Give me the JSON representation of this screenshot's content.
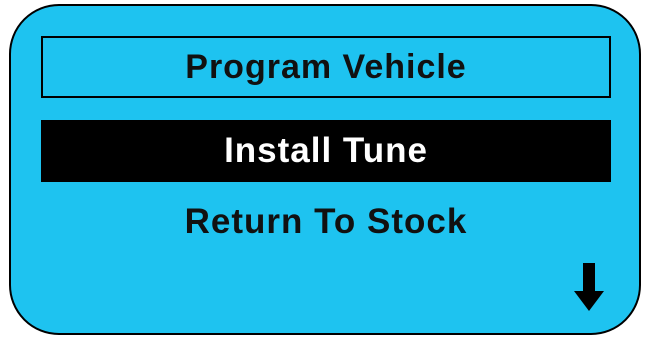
{
  "screen": {
    "background_color": "#1ec3f0",
    "title": "Program Vehicle",
    "menu": {
      "items": [
        {
          "label": "Install Tune",
          "selected": true
        },
        {
          "label": "Return To Stock",
          "selected": false
        }
      ],
      "scroll_indicator_icon": "arrow-down-icon"
    }
  }
}
